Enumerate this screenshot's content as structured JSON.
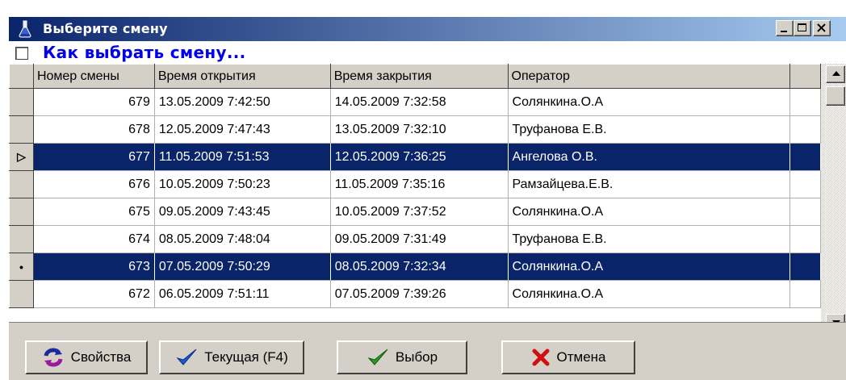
{
  "window": {
    "title": "Выберите смену",
    "controls": [
      "_",
      "□",
      "X"
    ]
  },
  "help": {
    "checkbox_checked": false,
    "link_text": "Как выбрать смену..."
  },
  "grid": {
    "columns": [
      "Номер смены",
      "Время открытия",
      "Время закрытия",
      "Оператор"
    ],
    "rows": [
      {
        "num": "679",
        "open": "13.05.2009 7:42:50",
        "close": "14.05.2009 7:32:58",
        "operator": "Солянкина.О.А",
        "indicator": "",
        "selected": false
      },
      {
        "num": "678",
        "open": "12.05.2009 7:47:43",
        "close": "13.05.2009 7:32:10",
        "operator": "Труфанова Е.В.",
        "indicator": "",
        "selected": false
      },
      {
        "num": "677",
        "open": "11.05.2009 7:51:53",
        "close": "12.05.2009 7:36:25",
        "operator": "Ангелова О.В.",
        "indicator": "▷",
        "selected": true
      },
      {
        "num": "676",
        "open": "10.05.2009 7:50:23",
        "close": "11.05.2009 7:35:16",
        "operator": "Рамзайцева.Е.В.",
        "indicator": "",
        "selected": false
      },
      {
        "num": "675",
        "open": "09.05.2009 7:43:45",
        "close": "10.05.2009 7:37:52",
        "operator": "Солянкина.О.А",
        "indicator": "",
        "selected": false
      },
      {
        "num": "674",
        "open": "08.05.2009 7:48:04",
        "close": "09.05.2009 7:31:49",
        "operator": "Труфанова Е.В.",
        "indicator": "",
        "selected": false
      },
      {
        "num": "673",
        "open": "07.05.2009 7:50:29",
        "close": "08.05.2009 7:32:34",
        "operator": "Солянкина.О.А",
        "indicator": "•",
        "selected": true
      },
      {
        "num": "672",
        "open": "06.05.2009 7:51:11",
        "close": "07.05.2009 7:39:26",
        "operator": "Солянкина.О.А",
        "indicator": "",
        "selected": false
      }
    ]
  },
  "buttons": {
    "properties": {
      "label": "Свойства",
      "icon": "refresh-icon"
    },
    "current": {
      "label": "Текущая (F4)",
      "icon": "checkmark-icon"
    },
    "select": {
      "label": "Выбор",
      "icon": "checkmark-icon"
    },
    "cancel": {
      "label": "Отмена",
      "icon": "close-x-icon"
    }
  },
  "colors": {
    "title_bar_start": "#0a246a",
    "title_bar_end": "#a6caf0",
    "selection": "#0a246a",
    "link": "#0000ee",
    "face": "#d4d0c8"
  }
}
